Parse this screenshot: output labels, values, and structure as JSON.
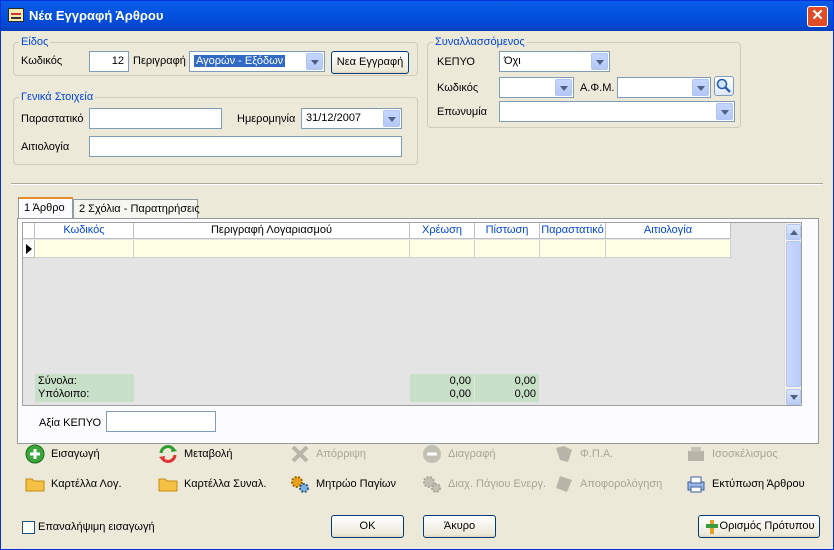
{
  "window": {
    "title": "Νέα Εγγραφή Άρθρου"
  },
  "eidos": {
    "group_label": "Είδος",
    "code_label": "Κωδικός",
    "code_value": "12",
    "description_label": "Περιγραφή",
    "description_value": "Αγορών - Εξόδων",
    "new_entry_button": "Νεα Εγγραφή"
  },
  "general": {
    "group_label": "Γενικά Στοιχεία",
    "document_label": "Παραστατικό",
    "document_value": "",
    "date_label": "Ημερομηνία",
    "date_value": "31/12/2007",
    "reason_label": "Αιτιολογία",
    "reason_value": ""
  },
  "counterparty": {
    "group_label": "Συναλλασσόμενος",
    "kepyo_label": "ΚΕΠΥΟ",
    "kepyo_value": "Όχι",
    "code_label": "Κωδικός",
    "code_value": "",
    "afm_label": "Α.Φ.Μ.",
    "afm_value": "",
    "name_label": "Επωνυμία",
    "name_value": ""
  },
  "tabs": [
    {
      "label": "1 Άρθρο",
      "active": true
    },
    {
      "label": "2 Σχόλια - Παρατηρήσεις",
      "active": false
    }
  ],
  "grid": {
    "columns": [
      "Κωδικός",
      "Περιγραφή Λογαριασμού",
      "Χρέωση",
      "Πίστωση",
      "Παραστατικό",
      "Αιτιολογία"
    ],
    "totals_label": "Σύνολα:",
    "balance_label": "Υπόλοιπο:",
    "totals_debit": "0,00",
    "totals_credit": "0,00",
    "balance_debit": "0,00",
    "balance_credit": "0,00"
  },
  "kepyo_value": {
    "label": "Αξία ΚΕΠΥΟ",
    "value": ""
  },
  "actions": {
    "insert": "Εισαγωγή",
    "modify": "Μεταβολή",
    "reject": "Απόρριψη",
    "delete": "Διαγραφή",
    "vat": "Φ.Π.Α.",
    "balance": "Ισοσκέλισμος",
    "account_card": "Καρτέλλα Λογ.",
    "party_card": "Καρτέλλα Συναλ.",
    "asset_register": "Μητρώο Παγίων",
    "asset_management": "Διαχ. Πάγιου Ενεργ.",
    "depreciation": "Αποφορολόγηση",
    "print_entry": "Εκτύπωση Άρθρου"
  },
  "footer": {
    "repeat_entry": "Επαναλήψιμη εισαγωγή",
    "ok": "OK",
    "cancel": "Άκυρο",
    "template": "Ορισμός Πρότυπου"
  },
  "colors": {
    "title_bar": "#0553e1",
    "group_label": "#0046d5",
    "grid_row": "#ffffe6",
    "totals": "#c8e0c8"
  }
}
